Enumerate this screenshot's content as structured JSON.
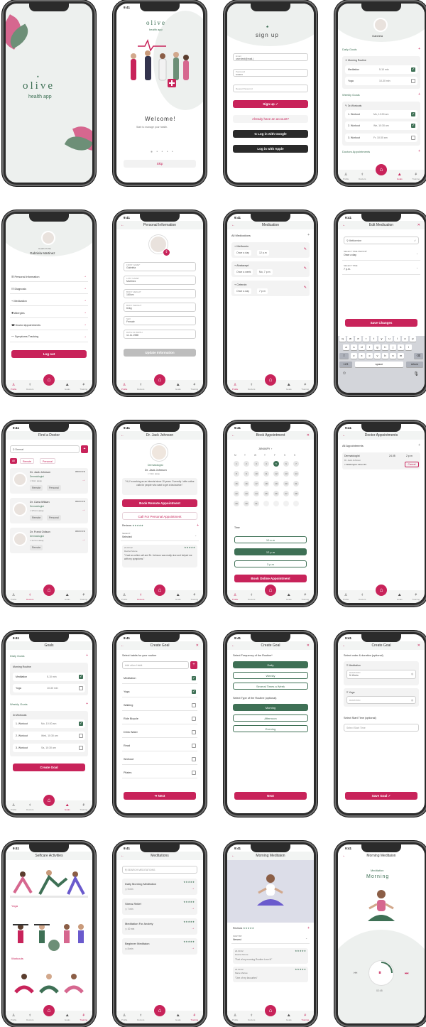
{
  "status": {
    "time": "9:41"
  },
  "tabs": {
    "profile": "Profile",
    "doctors": "Doctors",
    "goals": "Goals",
    "training": "Training"
  },
  "s1": {
    "brand": "olive",
    "tagline": "health app"
  },
  "s2": {
    "brand": "olive",
    "tagline": "health app",
    "title": "Welcome!",
    "subtitle": "Start to manage your health.",
    "skip": "Skip"
  },
  "s3": {
    "title": "sign up",
    "email_label": "Email",
    "email_value": "user.test@mail.|",
    "password_label": "Password",
    "password_value": "••••••••",
    "repeat_label": "Repeat Password",
    "signup": "Sign up",
    "have_account": "Already have an account?",
    "google": "Log in with Google",
    "apple": "Log in with Apple"
  },
  "s4": {
    "name": "Gabriela",
    "daily": "Daily Goals",
    "morning": "Morning Routine",
    "m1": "Meditation",
    "m1t": "5-10 min",
    "m2": "Yoga",
    "m2t": "10-30 min",
    "weekly": "Weekly Goals",
    "w": "3x Workouts",
    "r1": "1. Workout",
    "r1t": "Mo, 10:30 am",
    "r2": "2. Workout",
    "r2t": "We, 10:30 am",
    "r3": "3. Workout",
    "r3t": "Fr, 10:30 am",
    "appts": "Doctors Appointments"
  },
  "s5": {
    "label": "Health Profile",
    "name": "Gabriela Martinez",
    "items": [
      "Personal Information",
      "Diagnosis",
      "Medication",
      "Allergies",
      "Doctor Appointments",
      "Symptoms Tracking"
    ],
    "logout": "Log out"
  },
  "s6": {
    "title": "Personal Information",
    "fields": [
      {
        "l": "FIRST NAME*",
        "v": "Gabriela"
      },
      {
        "l": "LAST NAME*",
        "v": "Martinez"
      },
      {
        "l": "BODY HEIGHT",
        "v": "160cm"
      },
      {
        "l": "BODY WEIGHT",
        "v": "61kg"
      },
      {
        "l": "SEX",
        "v": "Female"
      },
      {
        "l": "DATE OF BIRTH",
        "v": "11.11.1988"
      }
    ],
    "update": "Update Information"
  },
  "s7": {
    "title": "Medication",
    "all": "All Medications",
    "meds": [
      {
        "n": "Metformin",
        "f": "Once a day",
        "t": "12 p.m"
      },
      {
        "n": "Abatacept",
        "f": "Once a week",
        "t": "Mo, 7 p.m"
      },
      {
        "n": "Cetercin",
        "f": "Once a day",
        "t": "7 p.m"
      }
    ]
  },
  "s8": {
    "title": "Edit Medication",
    "name": "Metformine",
    "period_l": "SELECT TIME PERIOD*",
    "period_v": "Once a day",
    "time_l": "SELECT TIME",
    "time_v": "7 p.m.",
    "save": "Save Changes",
    "rows": [
      "qwertyuiop",
      "asdfghjkl",
      "zxcvbnm"
    ],
    "k123": "123",
    "space": "space",
    "return": "return"
  },
  "s9": {
    "title": "Find a Doctor",
    "search": "Dermat",
    "filters": [
      "All",
      "Remote",
      "Personal"
    ],
    "docs": [
      {
        "n": "Dr. Jack Johnson",
        "s": "Dermatologist",
        "d": "3 km away",
        "tags": [
          "Remote",
          "Personal"
        ]
      },
      {
        "n": "Dr. Clara Wildan",
        "s": "Dermatologist",
        "d": "3.5 km away",
        "tags": [
          "Remote",
          "Personal"
        ]
      },
      {
        "n": "Dr. Frank Odison",
        "s": "Dermatologist",
        "d": "3.2 km away",
        "tags": [
          "Remote"
        ]
      }
    ]
  },
  "s10": {
    "title": "Dr. Jack Johnson",
    "spec": "Dermatologist",
    "name": "Dr. Jack Johnson",
    "dist": "3 km away",
    "quote": "\"Hi, I'm working as an internist since 10 years. Currently I offer online calls for people who want to get a fast advice.\"",
    "book": "Book Remote Appointment",
    "call": "Call For Personal Appointment",
    "reviews": "Reviews",
    "select_l": "SELECT",
    "select_v": "Selected",
    "rev_date": "24.03.22",
    "rev_name": "Rachel Monte",
    "rev_text": "\"I had an online call and Dr. Johnson was really nice and helped me with my symptoms.\""
  },
  "s11": {
    "title": "Book Appointment",
    "month": "JANUARY",
    "days": [
      "M",
      "T",
      "W",
      "T",
      "F",
      "S",
      "S"
    ],
    "dates": [
      "1",
      "2",
      "3",
      "4",
      "5",
      "6",
      "7",
      "8",
      "9",
      "10",
      "11",
      "12",
      "13",
      "14",
      "15",
      "16",
      "17",
      "18",
      "19",
      "20",
      "21",
      "22",
      "23",
      "24",
      "25",
      "26",
      "27",
      "28",
      "29",
      "30",
      "31"
    ],
    "selected": "5",
    "time": "Time",
    "slots": [
      "10 a.m",
      "12 p.m",
      "3 p.m"
    ],
    "book": "Book Online Appointment"
  },
  "s12": {
    "title": "Doctor Appointments",
    "all": "All Appointments",
    "spec": "Dermatologist",
    "doc": "Dr. Jack Johnson",
    "addr": "Washington street 33",
    "date": "24.05",
    "time": "2 p.m",
    "cancel": "Cancel"
  },
  "s13": {
    "title": "Goals",
    "daily": "Dialy Goals",
    "morning": "Morning Routine",
    "m1": "Meditation",
    "m1t": "5-10 min",
    "m2": "Yoga",
    "m2t": "10-30 min",
    "weekly": "Weekly Goals",
    "w": "3x Workouts",
    "r1": "1. Workout",
    "r1t": "Mo, 10:30 am",
    "r2": "2. Workout",
    "r2t": "Wed, 10:30 am",
    "r3": "3. Workout",
    "r3t": "Sa, 10:30 am",
    "create": "Create Goal"
  },
  "s14": {
    "title": "Create Goal",
    "prompt": "Select habits for your routine",
    "other": "Add other Habit",
    "habits": [
      "Meditation",
      "Yoga",
      "Walking",
      "Ride Bicycle",
      "Drink Water",
      "Read",
      "Workout",
      "Pilates"
    ],
    "next": "Next"
  },
  "s15": {
    "title": "Create Goal",
    "freq": "Select Frequency of the Routine*",
    "f": [
      "Daily",
      "Weekly",
      "Several Times a Week"
    ],
    "type": "Select Type of the Routine (optional)",
    "ty": [
      "Morning",
      "Afternoon",
      "Evening"
    ],
    "next": "Next"
  },
  "s16": {
    "title": "Create Goal",
    "order": "Select order & duration (optional)",
    "a": "Meditation",
    "al": "DURATION",
    "av": "5-10min",
    "b": "Yoga",
    "bl": "DURATION",
    "start": "Select Start Time (optional)",
    "start_ph": "Select Start Time",
    "save": "Save Goal"
  },
  "s17": {
    "title": "Selfcare Activities",
    "yoga": "Yoga",
    "workouts": "Workouts"
  },
  "s18": {
    "title": "Meditations",
    "search": "SEARCH MEDITATIONS",
    "items": [
      {
        "n": "Daily Morning Meditation",
        "t": "5 min"
      },
      {
        "n": "Stress Relief",
        "t": "7 min"
      },
      {
        "n": "Meditation For Anxiety",
        "t": "10 min"
      },
      {
        "n": "Beginner Meditaion",
        "t": "8 min"
      }
    ]
  },
  "s19": {
    "title": "Morning Meditaion",
    "reviews": "Reviews",
    "sort_l": "SORT BY",
    "sort_v": "Newest",
    "r1d": "24.03.22",
    "r1n": "Rachel Monte",
    "r1t": "\"Part of my morning Routine.Love it!\"",
    "r2d": "24.03.22",
    "r2n": "Marie Mellow",
    "r2t": "\"One of my favourites\""
  },
  "s20": {
    "title": "Morning Meditaion",
    "sub": "Meditation",
    "big": "Morning",
    "elapsed": "02:45"
  },
  "colors": {
    "accent": "#c8235a",
    "green": "#3e7055",
    "bg": "#f2f4f3"
  }
}
